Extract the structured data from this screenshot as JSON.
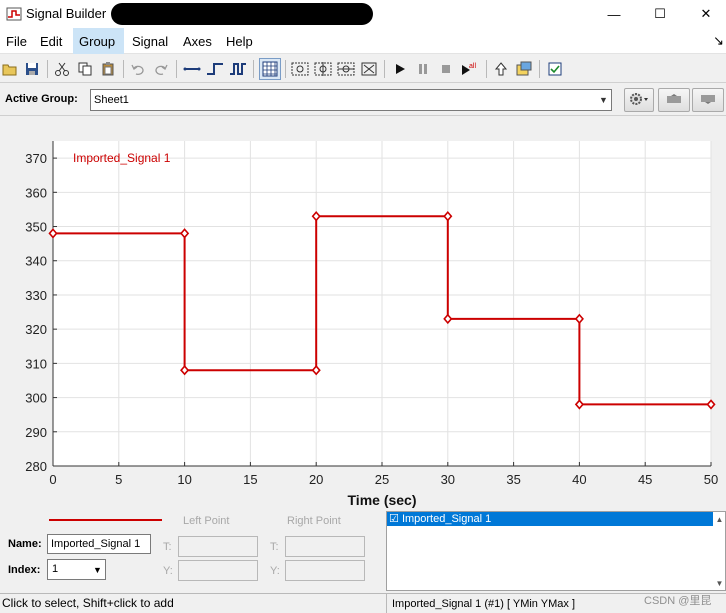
{
  "window": {
    "title": "Signal Builder",
    "minimize_glyph": "—",
    "maximize_glyph": "☐",
    "close_glyph": "✕"
  },
  "menu": {
    "items": [
      "File",
      "Edit",
      "Group",
      "Signal",
      "Axes",
      "Help"
    ],
    "overflow_glyph": "↘"
  },
  "active_group": {
    "label": "Active Group:",
    "value": "Sheet1"
  },
  "chart_data": {
    "type": "line",
    "series": [
      {
        "name": "Imported_Signal 1",
        "color": "#cc0000",
        "points": [
          [
            0,
            348
          ],
          [
            10,
            348
          ],
          [
            10,
            308
          ],
          [
            20,
            308
          ],
          [
            20,
            353
          ],
          [
            30,
            353
          ],
          [
            30,
            323
          ],
          [
            40,
            323
          ],
          [
            40,
            298
          ],
          [
            50,
            298
          ]
        ]
      }
    ],
    "xlabel": "Time (sec)",
    "xlim": [
      0,
      50
    ],
    "ylim": [
      280,
      375
    ],
    "xticks": [
      0,
      5,
      10,
      15,
      20,
      25,
      30,
      35,
      40,
      45,
      50
    ],
    "yticks": [
      280,
      290,
      300,
      310,
      320,
      330,
      340,
      350,
      360,
      370
    ],
    "grid": true,
    "legend_position": "top-left"
  },
  "bottom": {
    "left_point": "Left Point",
    "right_point": "Right Point",
    "name_label": "Name:",
    "name_value": "Imported_Signal 1",
    "index_label": "Index:",
    "index_value": "1",
    "t_label": "T:",
    "y_label": "Y:",
    "signal_list": [
      "Imported_Signal 1"
    ]
  },
  "status": {
    "left": "Click to select, Shift+click to add",
    "right": "Imported_Signal 1 (#1)  [ YMin YMax ]",
    "watermark": "CSDN @里昆"
  },
  "colors": {
    "accent": "#0078d7",
    "signal": "#cc0000",
    "menu_highlight": "#cce4f7"
  }
}
